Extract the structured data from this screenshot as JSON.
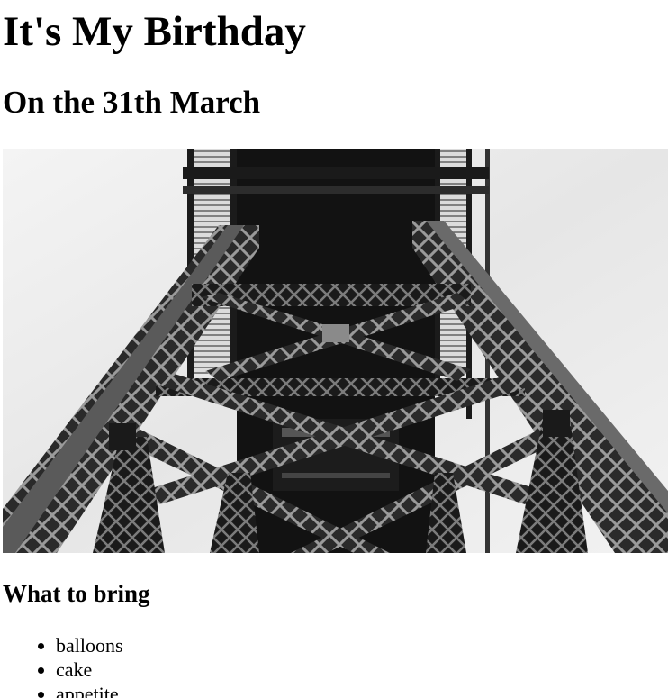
{
  "page": {
    "title": "It's My Birthday",
    "subtitle": "On the 31th March"
  },
  "photo": {
    "subject": "steel-lattice-tower",
    "palette": {
      "sky": "#ededed",
      "steel": "#2b2b2b",
      "steel_dark": "#111111",
      "steel_light": "#6d6d6d"
    }
  },
  "bring": {
    "heading": "What to bring",
    "items": [
      "balloons",
      "cake",
      "appetite"
    ]
  }
}
